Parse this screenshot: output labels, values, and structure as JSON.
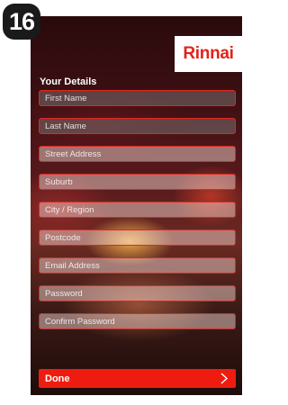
{
  "step": {
    "number": "16"
  },
  "brand": {
    "logo_text": "Rinnai",
    "color": "#e2231a"
  },
  "form": {
    "section_title": "Your Details",
    "fields": [
      {
        "placeholder": "First Name"
      },
      {
        "placeholder": "Last Name"
      },
      {
        "placeholder": "Street Address"
      },
      {
        "placeholder": "Suburb"
      },
      {
        "placeholder": "City / Region"
      },
      {
        "placeholder": "Postcode"
      },
      {
        "placeholder": "Email Address"
      },
      {
        "placeholder": "Password"
      },
      {
        "placeholder": "Confirm Password"
      }
    ],
    "done_label": "Done",
    "accent_color": "#ee1c10"
  },
  "icons": {
    "done_chevron": "chevron-right-icon"
  }
}
